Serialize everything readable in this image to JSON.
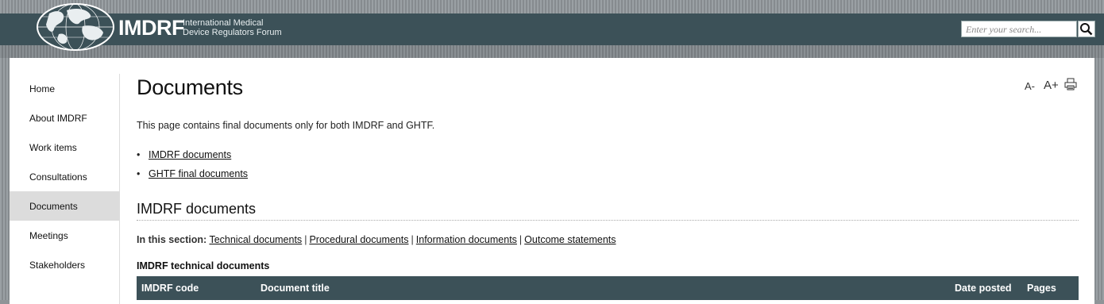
{
  "brand": {
    "abbr": "IMDRF",
    "name_line1": "International Medical",
    "name_line2": "Device Regulators Forum"
  },
  "search": {
    "placeholder": "Enter your search..."
  },
  "sidebar": {
    "items": [
      {
        "label": "Home"
      },
      {
        "label": "About IMDRF"
      },
      {
        "label": "Work items"
      },
      {
        "label": "Consultations"
      },
      {
        "label": "Documents"
      },
      {
        "label": "Meetings"
      },
      {
        "label": "Stakeholders"
      }
    ]
  },
  "page": {
    "title": "Documents",
    "tools": {
      "decrease": "A-",
      "increase": "A+"
    },
    "intro": "This page contains final documents only for both IMDRF and GHTF.",
    "links": [
      "IMDRF documents",
      "GHTF final documents"
    ],
    "section_title": "IMDRF documents",
    "in_section_label": "In this section:",
    "in_section_links": [
      "Technical documents",
      "Procedural documents",
      "Information documents",
      "Outcome statements"
    ],
    "in_section_separator": "|",
    "subhead": "IMDRF technical documents",
    "table_headers": [
      "IMDRF code",
      "Document title",
      "Date posted",
      "Pages"
    ]
  },
  "colors": {
    "header_bg": "#3c5158",
    "active_nav_bg": "#dcdcdc"
  }
}
